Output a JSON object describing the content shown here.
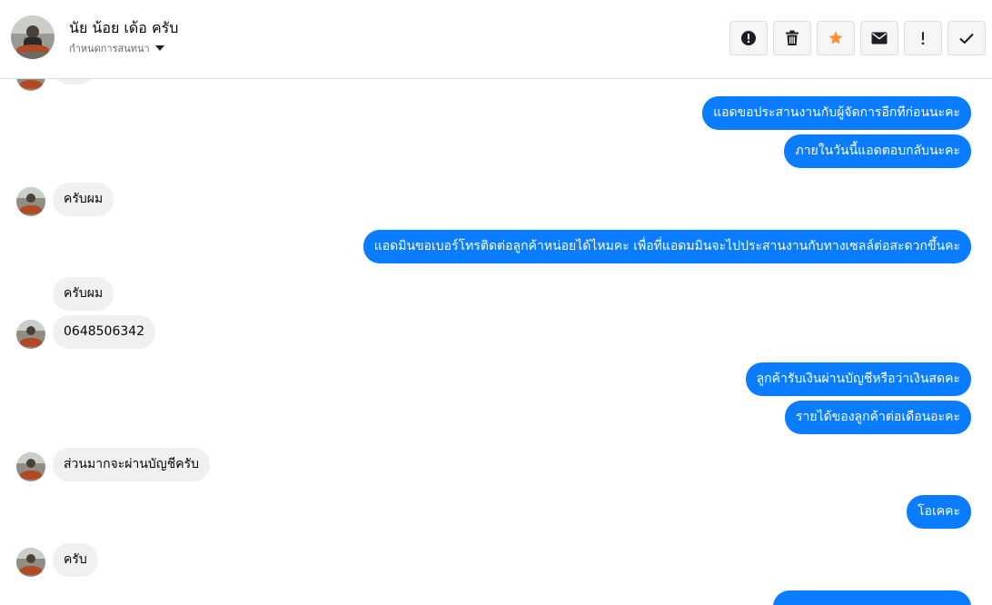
{
  "header": {
    "name": "นัย น้อย เด้อ ครับ",
    "subtitle": "กำหนดการสนทนา",
    "icons": [
      "alert-circle-icon",
      "trash-icon",
      "star-icon",
      "envelope-icon",
      "exclamation-icon",
      "check-icon"
    ],
    "star_color": "#f7923a"
  },
  "messages": [
    {
      "dir": "out",
      "text": "แอดขอประสานงานกับผู้จัดการอีกทีก่อนนะคะ"
    },
    {
      "dir": "out",
      "text": "ภายในวันนี้แอดตอบกลับนะคะ"
    },
    {
      "dir": "in",
      "text": "ครับผม"
    },
    {
      "dir": "out",
      "text": "แอดมินขอเบอร์โทรติดต่อลูกค้าหน่อยได้ไหมคะ เพื่อที่แอดมมินจะไปประสานงานกับทางเซลล์ต่อสะดวกขึ้นคะ"
    },
    {
      "dir": "in",
      "text": "ครับผม"
    },
    {
      "dir": "in",
      "text": "0648506342"
    },
    {
      "dir": "out",
      "text": "ลูกค้ารับเงินผ่านบัญชีหรือว่าเงินสดคะ"
    },
    {
      "dir": "out",
      "text": "รายได้ของลูกค้าต่อเดือนอะคะ"
    },
    {
      "dir": "in",
      "text": "ส่วนมากจะผ่านบัญชีครับ"
    },
    {
      "dir": "out",
      "text": "โอเคคะ"
    },
    {
      "dir": "in",
      "text": "ครับ"
    }
  ],
  "colors": {
    "outgoing_bubble": "#0a7cff",
    "incoming_bubble": "#f0f0f0"
  }
}
